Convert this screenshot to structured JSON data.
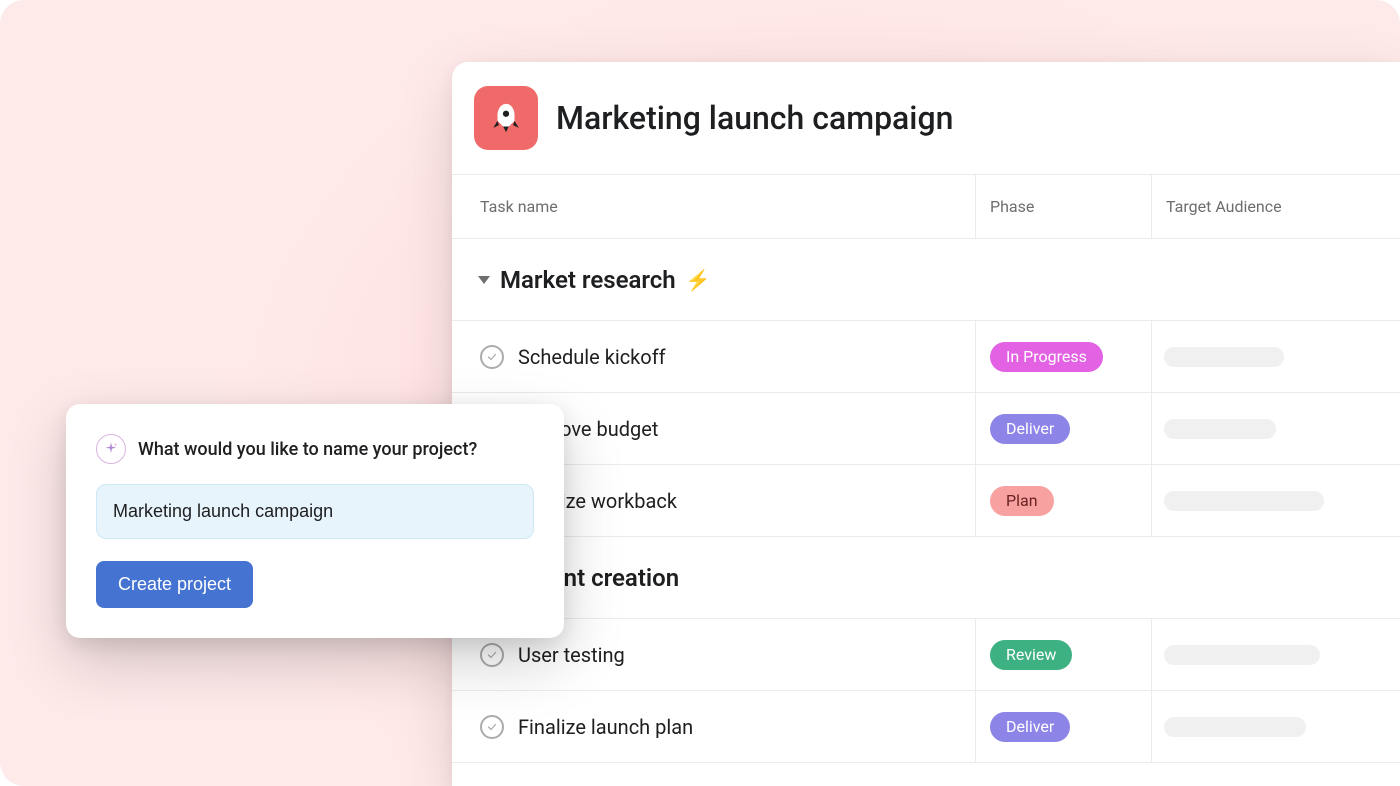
{
  "project": {
    "title": "Marketing launch campaign",
    "icon_name": "rocket-icon"
  },
  "columns": {
    "task": "Task name",
    "phase": "Phase",
    "audience": "Target Audience"
  },
  "sections": [
    {
      "title": "Market research",
      "emoji": "⚡",
      "tasks": [
        {
          "name": "Schedule kickoff",
          "phase": {
            "label": "In Progress",
            "bg": "#e362e3",
            "fg": "#ffffff"
          },
          "placeholder_width": 120
        },
        {
          "name": "Approve budget",
          "phase": {
            "label": "Deliver",
            "bg": "#8d84e8",
            "fg": "#ffffff"
          },
          "placeholder_width": 112
        },
        {
          "name": "Finalize workback",
          "phase": {
            "label": "Plan",
            "bg": "#f8a1a1",
            "fg": "#6b2222"
          },
          "placeholder_width": 160
        }
      ]
    },
    {
      "title": "Content creation",
      "emoji": "",
      "tasks": [
        {
          "name": "User testing",
          "phase": {
            "label": "Review",
            "bg": "#3db182",
            "fg": "#ffffff"
          },
          "placeholder_width": 156
        },
        {
          "name": "Finalize launch plan",
          "phase": {
            "label": "Deliver",
            "bg": "#8d84e8",
            "fg": "#ffffff"
          },
          "placeholder_width": 142
        }
      ]
    }
  ],
  "modal": {
    "prompt": "What would you like to name your project?",
    "input_value": "Marketing launch campaign",
    "button_label": "Create project"
  }
}
